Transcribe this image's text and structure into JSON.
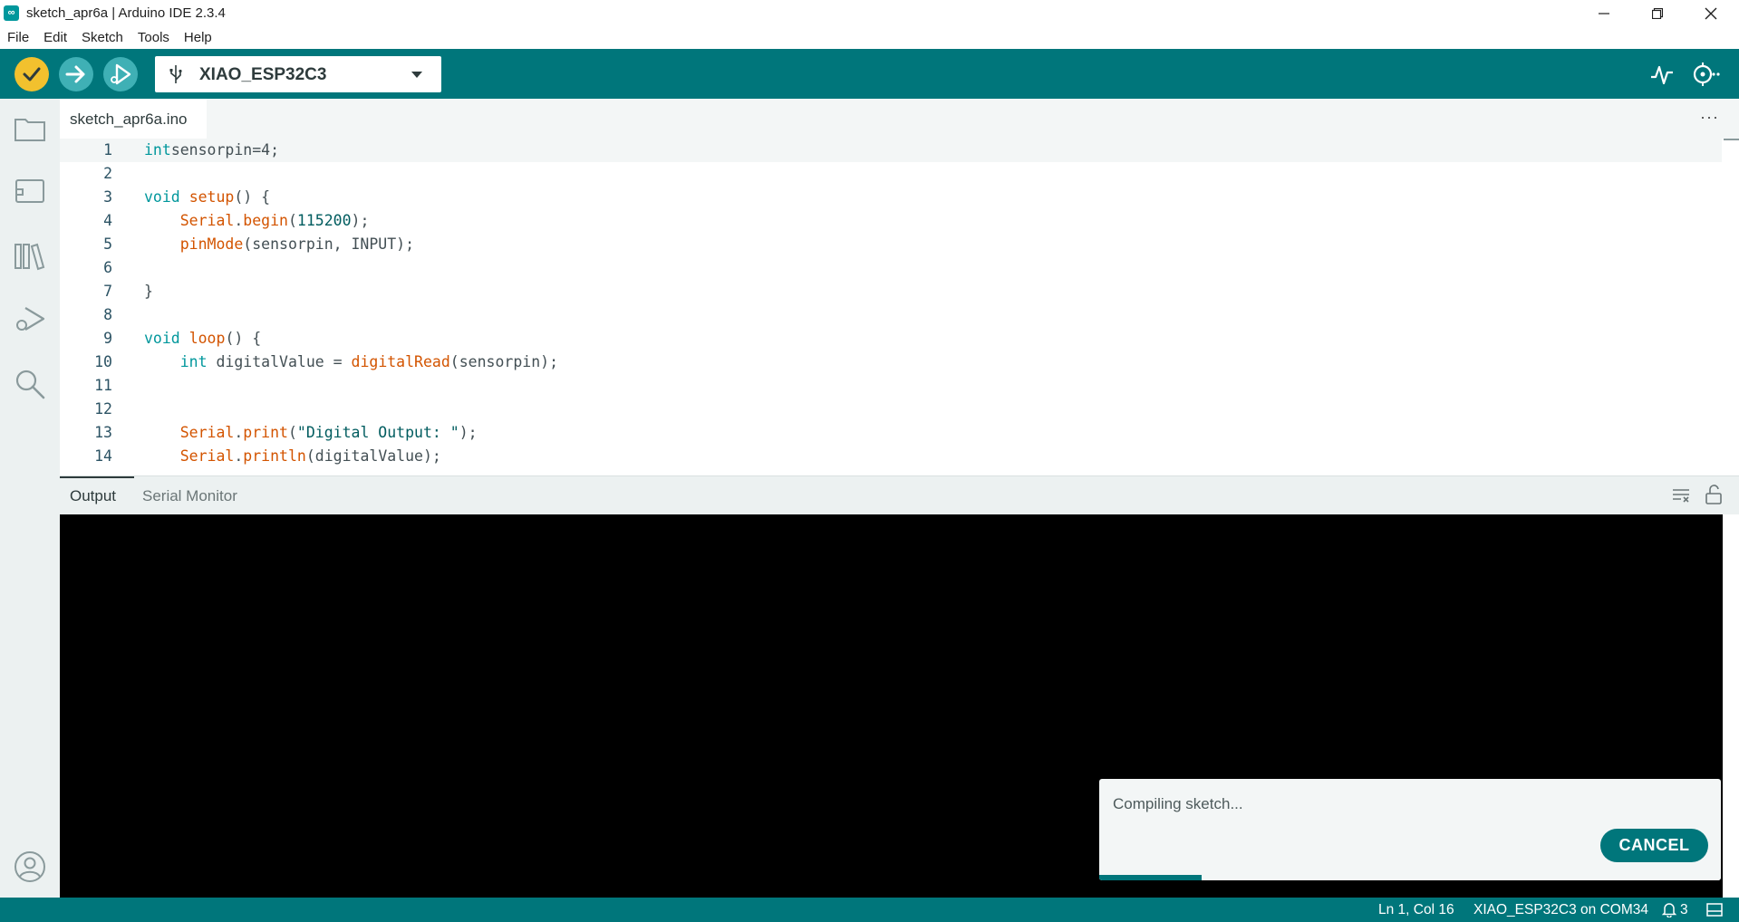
{
  "window": {
    "title": "sketch_apr6a | Arduino IDE 2.3.4",
    "app_icon_glyph": "∞"
  },
  "menu": {
    "items": [
      "File",
      "Edit",
      "Sketch",
      "Tools",
      "Help"
    ]
  },
  "toolbar": {
    "board": "XIAO_ESP32C3",
    "verify_color": "#f2c12e",
    "accent_color": "#00767b"
  },
  "editor": {
    "file_tab": "sketch_apr6a.ino",
    "more_options": "···",
    "lines": [
      {
        "num": "1",
        "tokens": [
          [
            "k",
            "int"
          ],
          [
            "",
            "sensorpin=4;"
          ]
        ]
      },
      {
        "num": "2",
        "tokens": []
      },
      {
        "num": "3",
        "tokens": [
          [
            "k",
            "void"
          ],
          [
            "",
            "",
            " "
          ],
          [
            "f",
            "setup"
          ],
          [
            "",
            "() {"
          ]
        ]
      },
      {
        "num": "4",
        "tokens": [
          [
            "",
            "    "
          ],
          [
            "f",
            "Serial"
          ],
          [
            "",
            "."
          ],
          [
            "f",
            "begin"
          ],
          [
            "",
            "("
          ],
          [
            "n",
            "115200"
          ],
          [
            "",
            ");"
          ]
        ]
      },
      {
        "num": "5",
        "tokens": [
          [
            "",
            "    "
          ],
          [
            "f",
            "pinMode"
          ],
          [
            "",
            "(sensorpin, INPUT);"
          ]
        ]
      },
      {
        "num": "6",
        "tokens": []
      },
      {
        "num": "7",
        "tokens": [
          [
            "",
            "}"
          ]
        ]
      },
      {
        "num": "8",
        "tokens": []
      },
      {
        "num": "9",
        "tokens": [
          [
            "k",
            "void"
          ],
          [
            "",
            "",
            " "
          ],
          [
            "f",
            "loop"
          ],
          [
            "",
            "() {"
          ]
        ]
      },
      {
        "num": "10",
        "tokens": [
          [
            "",
            "    "
          ],
          [
            "k",
            "int"
          ],
          [
            "",
            "",
            " digitalValue = "
          ],
          [
            "f",
            "digitalRead"
          ],
          [
            "",
            "(sensorpin);"
          ]
        ]
      },
      {
        "num": "11",
        "tokens": []
      },
      {
        "num": "12",
        "tokens": []
      },
      {
        "num": "13",
        "tokens": [
          [
            "",
            "    "
          ],
          [
            "f",
            "Serial"
          ],
          [
            "",
            "."
          ],
          [
            "f",
            "print"
          ],
          [
            "",
            "("
          ],
          [
            "s",
            "\"Digital Output: \""
          ],
          [
            "",
            ");"
          ]
        ]
      },
      {
        "num": "14",
        "tokens": [
          [
            "",
            "    "
          ],
          [
            "f",
            "Serial"
          ],
          [
            "",
            "."
          ],
          [
            "f",
            "println"
          ],
          [
            "",
            "(digitalValue);"
          ]
        ]
      }
    ]
  },
  "panel": {
    "tabs": [
      "Output",
      "Serial Monitor"
    ],
    "active_tab": "Output"
  },
  "notification": {
    "message": "Compiling sketch...",
    "cancel_label": "CANCEL",
    "progress_fraction": 0.164
  },
  "statusbar": {
    "position": "Ln 1, Col 16",
    "board_port": "XIAO_ESP32C3 on COM34",
    "notification_count": "3"
  }
}
